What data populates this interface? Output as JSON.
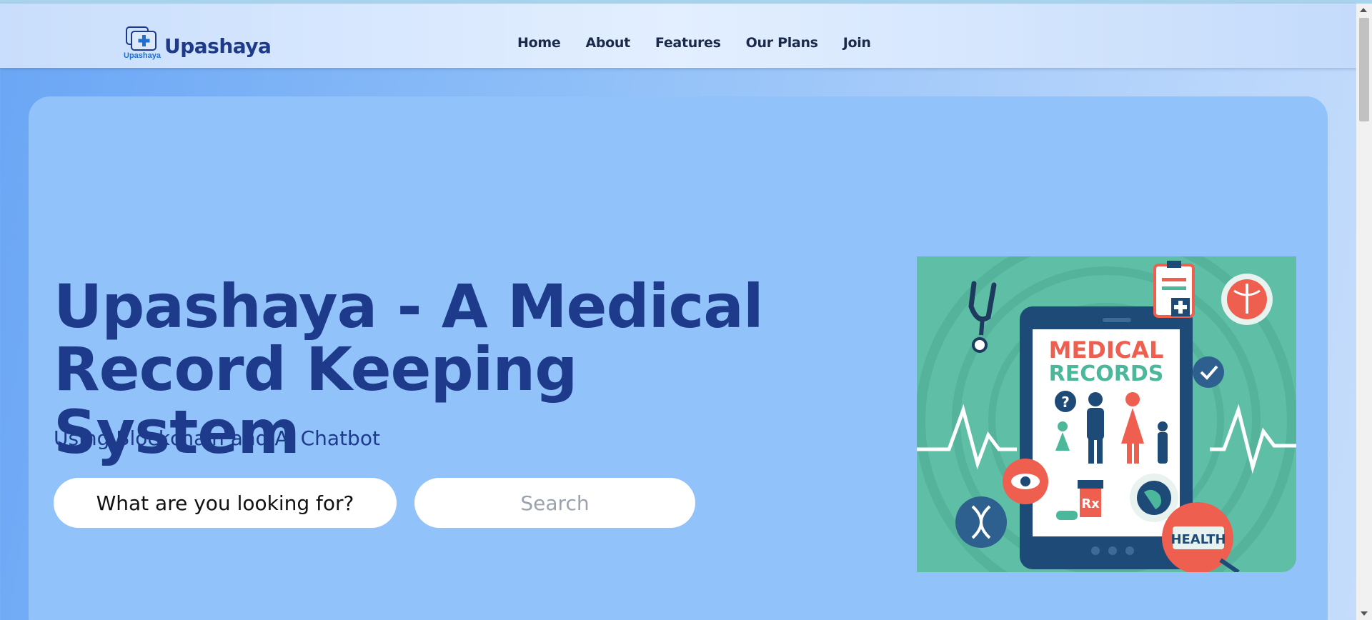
{
  "brand": {
    "logo_caption": "Upashaya",
    "name": "Upashaya"
  },
  "nav": {
    "items": [
      {
        "label": "Home"
      },
      {
        "label": "About"
      },
      {
        "label": "Features"
      },
      {
        "label": "Our Plans"
      },
      {
        "label": "Join"
      }
    ]
  },
  "hero": {
    "title": "Upashaya - A Medical Record Keeping System",
    "subtitle": "Using Blockchain and AI Chatbot",
    "search": {
      "placeholder": "What are you looking for?",
      "button_label": "Search"
    },
    "image": {
      "heading_line1": "MEDICAL",
      "heading_line2": "RECORDS",
      "badge": "HEALTH",
      "rx": "Rx",
      "question": "?"
    }
  },
  "colors": {
    "accent": "#1e3a8a",
    "card": "#92c2fa",
    "image_bg": "#5fbfa6",
    "coral": "#ef5f4f"
  }
}
